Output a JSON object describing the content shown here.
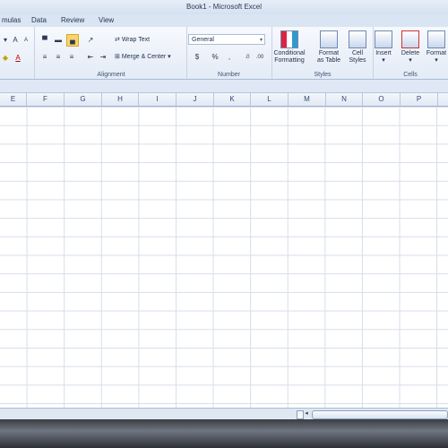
{
  "window": {
    "title": "Book1 - Microsoft Excel"
  },
  "tabs": [
    "mulas",
    "Data",
    "Review",
    "View"
  ],
  "ribbon": {
    "alignment": {
      "label": "Alignment",
      "wrap_text": "Wrap Text",
      "merge_center": "Merge & Center"
    },
    "number": {
      "label": "Number",
      "format": "General",
      "currency": "$",
      "percent": "%",
      "comma": ","
    },
    "styles": {
      "label": "Styles",
      "conditional": [
        "Conditional",
        "Formatting"
      ],
      "format_table": [
        "Format",
        "as Table"
      ],
      "cell_styles": [
        "Cell",
        "Styles"
      ]
    },
    "cells": {
      "label": "Cells",
      "insert": "Insert",
      "delete": "Delete",
      "format": "Format"
    }
  },
  "columns": [
    "E",
    "F",
    "G",
    "H",
    "I",
    "J",
    "K",
    "L",
    "M",
    "N",
    "O",
    "P"
  ]
}
